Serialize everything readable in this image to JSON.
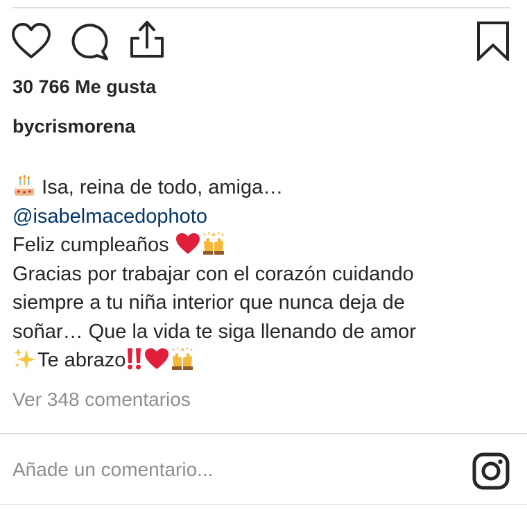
{
  "post": {
    "likes_text": "30 766 Me gusta",
    "username": "bycrismorena",
    "caption": {
      "line1_text": "Isa, reina de todo, amiga…",
      "mention": "@isabelmacedophoto",
      "line3_text": "Feliz cumpleaños",
      "line4_text": "Gracias por trabajar con el corazón cuidando",
      "line5_text": "siempre a tu niña interior que nunca deja de",
      "line6_text": "soñar… Que la vida te siga llenando de amor",
      "line7_text": "Te abrazo",
      "emojis": [
        "birthday-cake",
        "red-heart",
        "raising-hands",
        "sparkles",
        "double-exclamation"
      ]
    },
    "view_comments": "Ver 348 comentarios"
  },
  "comment_box": {
    "placeholder": "Añade un comentario..."
  },
  "icons": [
    "heart-icon",
    "comment-icon",
    "share-icon",
    "bookmark-icon",
    "instagram-icon"
  ],
  "colors": {
    "text": "#262626",
    "mention": "#003569",
    "muted": "#8e8e8e",
    "divider": "#dbdbdb",
    "heart_emoji": "#e0203a",
    "hands_emoji": "#f5b93a"
  }
}
